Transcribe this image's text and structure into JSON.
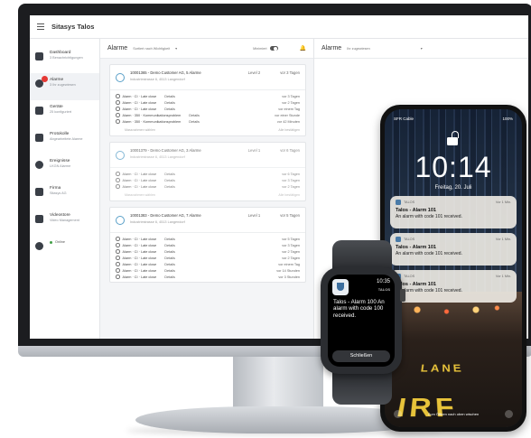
{
  "app": {
    "title": "Sitasys Talos"
  },
  "sidebar": {
    "items": [
      {
        "label": "Dashboard",
        "sub": "3 Benachrichtigungen"
      },
      {
        "label": "Alarme",
        "sub": "3 Ihr zugewiesen"
      },
      {
        "label": "Geräte",
        "sub": "25 konfiguriert"
      },
      {
        "label": "Protokolle",
        "sub": "Abgearbeitete Alarme"
      },
      {
        "label": "Ereignisse",
        "sub": "LKGN Alarme"
      },
      {
        "label": "Firma",
        "sub": "Sitasys AG"
      },
      {
        "label": "Videostore",
        "sub": "Video Management"
      }
    ],
    "status": "Online"
  },
  "alarms": {
    "title": "Alarme",
    "sort": "Sortiert nach Wichtigkeit",
    "filter_label": "Minimiert",
    "cards": [
      {
        "title": "10001365 - Demo Customer AG, 5 Alarme",
        "level": "Level 2",
        "time": "vor 3 Tagen",
        "address": "Industriestrasse 6, 4513 Langendorf",
        "rows": [
          {
            "text": "Alarm · CI · Late close",
            "detail": "Details",
            "time": "vor 3 Tagen"
          },
          {
            "text": "Alarm · CI · Late close",
            "detail": "Details",
            "time": "vor 2 Tagen"
          },
          {
            "text": "Alarm · CI · Late close",
            "detail": "Details",
            "time": "vor einem Tag"
          },
          {
            "text": "Alarm · 350 · Kommunikationsproblem",
            "detail": "Details",
            "time": "vor einer Stunde"
          },
          {
            "text": "Alarm · 350 · Kommunikationsproblem",
            "detail": "Details",
            "time": "vor 42 Minuten"
          }
        ],
        "footer_left": "Massnahmen wählen",
        "footer_right": "Alle bestätigen"
      },
      {
        "title": "10001379 - Demo Customer AG, 3 Alarme",
        "level": "Level 1",
        "time": "vor 6 Tagen",
        "address": "Industriestrasse 6, 4513 Langendorf",
        "rows": [
          {
            "text": "Alarm · CI · Late close",
            "detail": "Details",
            "time": "vor 6 Tagen"
          },
          {
            "text": "Alarm · CI · Late close",
            "detail": "Details",
            "time": "vor 3 Tagen"
          },
          {
            "text": "Alarm · CI · Late close",
            "detail": "Details",
            "time": "vor 2 Tagen"
          }
        ],
        "footer_left": "Massnahmen wählen",
        "footer_right": "Alle bestätigen"
      },
      {
        "title": "10001383 - Demo Customer AG, 7 Alarme",
        "level": "Level 1",
        "time": "vor 5 Tagen",
        "address": "Industriestrasse 6, 4513 Langendorf",
        "rows": [
          {
            "text": "Alarm · CI · Late close",
            "detail": "Details",
            "time": "vor 5 Tagen"
          },
          {
            "text": "Alarm · CI · Late close",
            "detail": "Details",
            "time": "vor 3 Tagen"
          },
          {
            "text": "Alarm · CI · Late close",
            "detail": "Details",
            "time": "vor 2 Tagen"
          },
          {
            "text": "Alarm · CI · Late close",
            "detail": "Details",
            "time": "vor 2 Tagen"
          },
          {
            "text": "Alarm · CI · Late close",
            "detail": "Details",
            "time": "vor einem Tag"
          },
          {
            "text": "Alarm · CI · Late close",
            "detail": "Details",
            "time": "vor 14 Stunden"
          },
          {
            "text": "Alarm · CI · Late close",
            "detail": "Details",
            "time": "vor 3 Stunden"
          }
        ],
        "footer_left": "",
        "footer_right": ""
      }
    ]
  },
  "alarms_right": {
    "title": "Alarme",
    "sort": "Ihr zugewiesen"
  },
  "phone": {
    "carrier": "SFR Cable",
    "battery": "100%",
    "time": "10:14",
    "date": "Freitag, 20. Juli",
    "notifications": [
      {
        "app": "TALOS",
        "when": "Vor 1 Min.",
        "title": "Talos - Alarm 101",
        "body": "An alarm with code 101 received."
      },
      {
        "app": "TALOS",
        "when": "Vor 1 Min.",
        "title": "Talos - Alarm 101",
        "body": "An alarm with code 101 received."
      },
      {
        "app": "TALOS",
        "when": "Vor 1 Min.",
        "title": "Talos - Alarm 101",
        "body": "An alarm with code 101 received."
      }
    ],
    "bottom_hint": "Zum Öffnen nach oben wischen",
    "road_text_1": "LANE",
    "road_text_2": "IRF"
  },
  "watch": {
    "time": "10:35",
    "app": "TALOS",
    "message": "Talos - Alarm 100 An alarm with code 100 received.",
    "button": "Schließen"
  },
  "colors": {
    "accent": "#5aa0c8",
    "badge": "#e53935",
    "online": "#43a047",
    "road_paint": "#e8c33a"
  }
}
